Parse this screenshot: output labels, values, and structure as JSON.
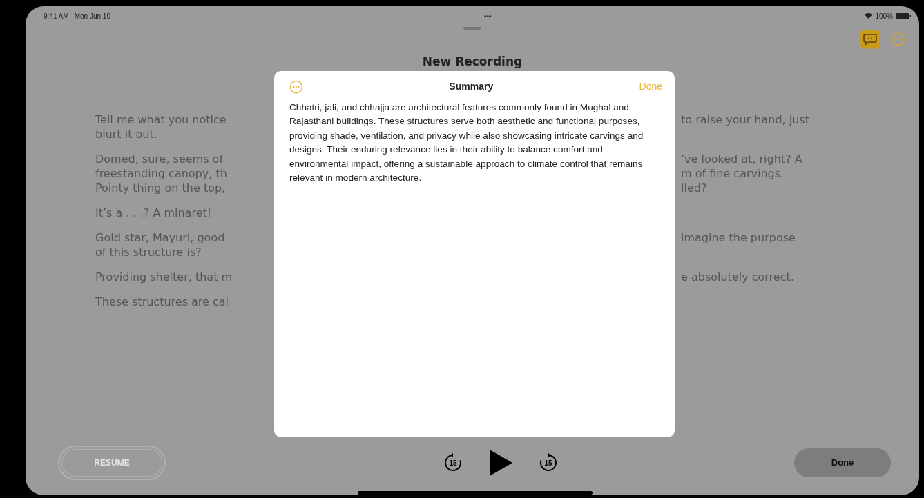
{
  "status_bar": {
    "time": "9:41 AM",
    "date": "Mon Jun 10",
    "dots": "•••",
    "battery": "100%"
  },
  "toolbar_buttons": [
    {
      "kind": "transcript",
      "selected": true
    },
    {
      "kind": "more",
      "selected": false
    }
  ],
  "title": "New Recording",
  "transcript": [
    {
      "left": "Tell me what you notice\nblurt it out.",
      "right": "to raise your hand, just"
    },
    {
      "left": "Domed, sure, seems of\nfreestanding canopy, th\nPointy thing on the top,",
      "right": "’ve looked at, right? A\nm of fine carvings.\nlled?"
    },
    {
      "left": "It’s a . . .? A minaret!"
    },
    {
      "left": "Gold star, Mayuri, good\nof this structure is?",
      "right": "imagine the purpose"
    },
    {
      "left": "Providing shelter, that m",
      "right": "e absolutely correct."
    },
    {
      "left": "These structures are cal"
    }
  ],
  "summary": {
    "title": "Summary",
    "done": "Done",
    "text": "Chhatri, jali, and chhajja are architectural features commonly found in Mughal and Rajasthani buildings. These structures serve both aesthetic and functional purposes, providing shade, ventilation, and privacy while also showcasing intricate carvings and designs. Their enduring relevance lies in their ability to balance comfort and environmental impact, offering a sustainable approach to climate control that remains relevant in modern architecture."
  },
  "controls": {
    "resume": "RESUME",
    "resume_disabled": true,
    "skip_back": "15",
    "skip_forward": "15",
    "done": "Done"
  }
}
